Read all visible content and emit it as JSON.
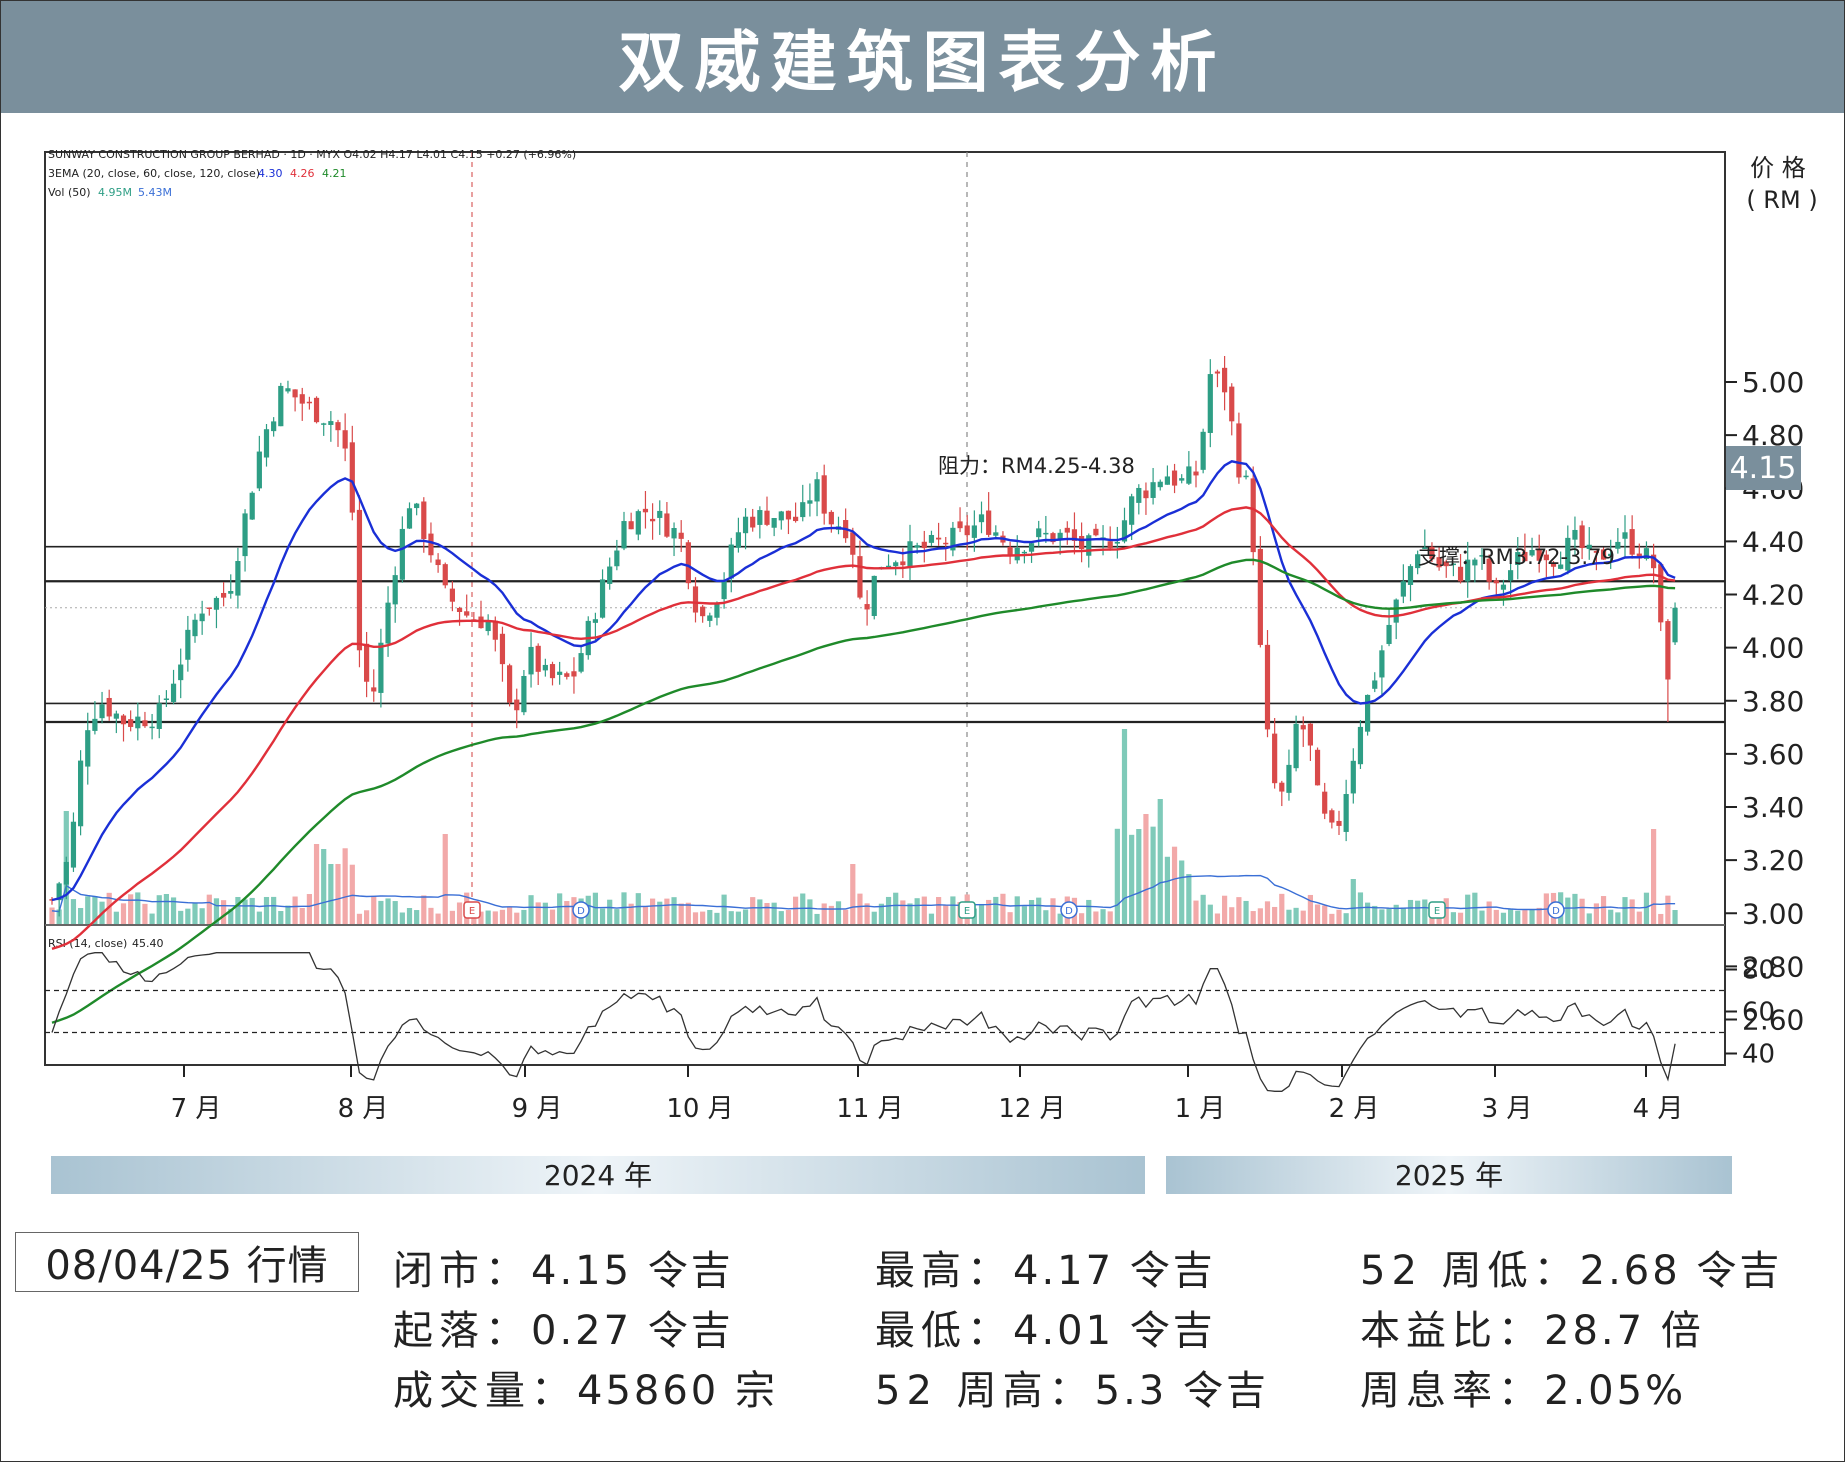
{
  "header": {
    "title": "双威建筑图表分析"
  },
  "chart_data": {
    "type": "candlestick",
    "legend_lines": [
      "SUNWAY CONSTRUCTION GROUP BERHAD · 1D · MYX  O4.02  H4.17  L4.01  C4.15  +0.27 (+6.96%)",
      "3EMA (20, close, 60, close, 120, close)",
      "Vol (50)"
    ],
    "ema_values": [
      "4.30",
      "4.26",
      "4.21"
    ],
    "vol_values": [
      "4.95M",
      "5.43M"
    ],
    "rsi_label": "RSI (14, close)",
    "rsi_value": "45.40",
    "y_axis": {
      "title": "价 格",
      "unit": "( RM )",
      "ylim": [
        2.5,
        5.35
      ],
      "ticks": [
        "5.00",
        "4.80",
        "4.60",
        "4.40",
        "4.20",
        "4.00",
        "3.80",
        "3.60",
        "3.40",
        "3.20",
        "3.00",
        "2.80",
        "2.60"
      ]
    },
    "last_price_label": "4.15",
    "rsi_axis": {
      "ticks": [
        "80",
        "60",
        "40"
      ],
      "ylim": [
        20,
        90
      ],
      "levels": [
        70,
        50
      ]
    },
    "x_axis": {
      "months": [
        "7 月",
        "8 月",
        "9 月",
        "10 月",
        "11 月",
        "12 月",
        "1 月",
        "2 月",
        "3 月",
        "4 月"
      ]
    },
    "year_bands": [
      "2024 年",
      "2025 年"
    ],
    "resistance": {
      "label": "阻力：RM4.25-4.38",
      "range": [
        4.25,
        4.38
      ]
    },
    "support": {
      "label": "支撑：RM3.72-3.79",
      "range": [
        3.72,
        3.79
      ]
    },
    "event_markers": [
      "E",
      "D",
      "E",
      "D",
      "E",
      "D"
    ],
    "series": [
      {
        "name": "EMA20",
        "color": "#1a2fd6"
      },
      {
        "name": "EMA60",
        "color": "#e0303a"
      },
      {
        "name": "EMA120",
        "color": "#1f8a2a"
      },
      {
        "name": "Vol MA50",
        "color": "#3a6fd6"
      },
      {
        "name": "RSI",
        "color": "#333333"
      }
    ],
    "colors": {
      "up": "#2e9e85",
      "down": "#d94a4a",
      "vol_up": "#7fcab9",
      "vol_down": "#f2a9a9"
    },
    "last_bar": {
      "date": "08/04/25",
      "open": 4.02,
      "high": 4.17,
      "low": 4.01,
      "close": 4.15
    }
  },
  "stats": {
    "date_label": "08/04/25 行情",
    "close": {
      "key": "闭市：",
      "value": "4.15 令吉"
    },
    "high": {
      "key": "最高：",
      "value": "4.17 令吉"
    },
    "low52": {
      "key": "52 周低：",
      "value": "2.68 令吉"
    },
    "change": {
      "key": "起落：",
      "value": "0.27 令吉"
    },
    "low": {
      "key": "最低：",
      "value": "4.01 令吉"
    },
    "pe": {
      "key": "本益比：",
      "value": "28.7 倍"
    },
    "volume": {
      "key": "成交量：",
      "value": "45860 宗"
    },
    "high52": {
      "key": "52 周高：",
      "value": "5.3 令吉"
    },
    "dy": {
      "key": "周息率：",
      "value": "2.05%"
    }
  }
}
